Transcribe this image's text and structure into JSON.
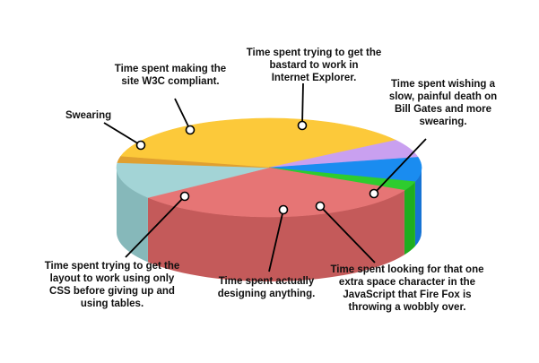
{
  "chart_data": {
    "type": "pie",
    "title": "",
    "slices": [
      {
        "label": "Time spent trying to get the bastard to work in Internet Explorer.",
        "value": 37,
        "color": "#FCC93A",
        "side": "#E0A828"
      },
      {
        "label": "Time spent wishing a slow, painful death on Bill Gates and more swearing.",
        "value": 6,
        "color": "#C9A0F0",
        "side": "#A97AD6"
      },
      {
        "label": "Time spent looking for that one extra space character in the JavaScript that Fire Fox is throwing a wobbly over.",
        "value": 8,
        "color": "#1A8CF0",
        "side": "#1673D4"
      },
      {
        "label": "Time spent actually designing anything.",
        "value": 3,
        "color": "#2ECC2E",
        "side": "#1FAE1F"
      },
      {
        "label": "Time spent trying to get the layout to work using only CSS before giving up and using tables.",
        "value": 32,
        "color": "#E67575",
        "side": "#C45A5A"
      },
      {
        "label": "Swearing",
        "value": 12,
        "color": "#A3D4D6",
        "side": "#86B8BA"
      },
      {
        "label": "Time spent making the site W3C compliant.",
        "value": 2,
        "color": "#E0A030",
        "side": "#C08420"
      }
    ],
    "legend": "none",
    "annotation_lines": [
      [
        "Time spent trying to get the",
        "bastard to work in",
        "Internet  Explorer."
      ],
      [
        "Time spent wishing a",
        "slow, painful death on",
        "Bill Gates and more",
        "swearing."
      ],
      [
        "Time spent looking for that one",
        "extra space character in the",
        "JavaScript that Fire Fox is",
        "throwing a wobbly over."
      ],
      [
        "Time spent actually",
        "designing anything."
      ],
      [
        "Time spent trying to get the",
        "layout to work using only",
        "CSS before giving up and",
        "using tables."
      ],
      [
        "Swearing"
      ],
      [
        "Time spent making the",
        "site W3C compliant."
      ]
    ]
  }
}
